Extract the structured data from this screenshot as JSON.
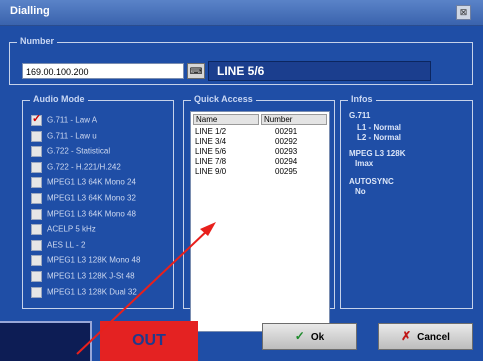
{
  "window": {
    "title": "Dialling",
    "close_glyph": "⊠"
  },
  "number": {
    "group_label": "Number",
    "input_value": "169.00.100.200",
    "keyboard_glyph": "⌨",
    "line_label": "LINE 5/6"
  },
  "audio_mode": {
    "group_label": "Audio Mode",
    "items": [
      {
        "label": "G.711 - Law A",
        "checked": true
      },
      {
        "label": "G.711 - Law u",
        "checked": false
      },
      {
        "label": "G.722 - Statistical",
        "checked": false
      },
      {
        "label": "G.722 - H.221/H.242",
        "checked": false
      },
      {
        "label": "MPEG1 L3 64K Mono 24",
        "checked": false
      },
      {
        "label": "MPEG1 L3 64K Mono 32",
        "checked": false
      },
      {
        "label": "MPEG1 L3 64K Mono 48",
        "checked": false
      },
      {
        "label": "ACELP 5 kHz",
        "checked": false
      },
      {
        "label": "AES LL - 2",
        "checked": false
      },
      {
        "label": "MPEG1 L3 128K Mono 48",
        "checked": false
      },
      {
        "label": "MPEG1 L3 128K J-St 48",
        "checked": false
      },
      {
        "label": "MPEG1 L3 128K Dual 32",
        "checked": false
      }
    ]
  },
  "quick_access": {
    "group_label": "Quick Access",
    "col_name": "Name",
    "col_number": "Number",
    "rows": [
      {
        "name": "LINE 1/2",
        "number": "00291"
      },
      {
        "name": "LINE 3/4",
        "number": "00292"
      },
      {
        "name": "LINE 5/6",
        "number": "00293"
      },
      {
        "name": "LINE 7/8",
        "number": "00294"
      },
      {
        "name": "LINE 9/0",
        "number": "00295"
      }
    ]
  },
  "info": {
    "group_label": "Infos",
    "lines": [
      "G.711",
      "L1 - Normal",
      "L2 - Normal",
      "MPEG L3 128K",
      "Imax",
      "AUTOSYNC",
      "No"
    ]
  },
  "buttons": {
    "ok_label": "Ok",
    "ok_icon": "✓",
    "cancel_label": "Cancel",
    "cancel_icon": "✗"
  },
  "overlay": {
    "out_label": "OUT",
    "arrow_color": "#e8201c"
  },
  "colors": {
    "window_bg": "#1f4ea6",
    "line_field": "#1b3e8e",
    "out_box": "#e42222"
  }
}
